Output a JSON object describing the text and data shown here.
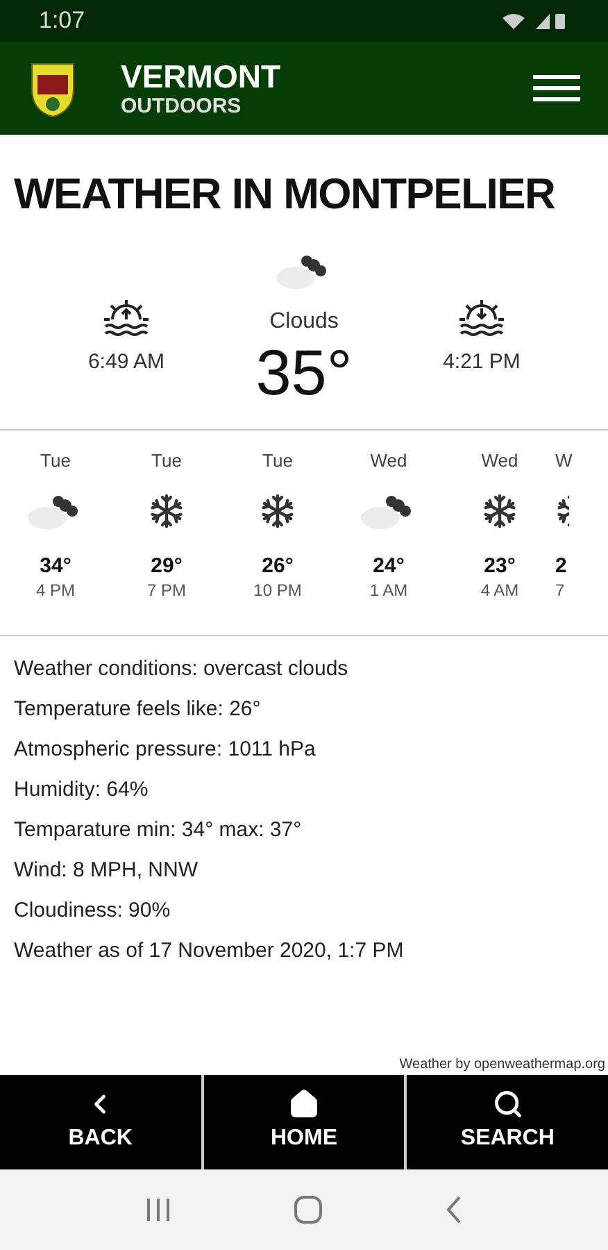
{
  "status_bar": {
    "time": "1:07"
  },
  "header": {
    "title": "VERMONT",
    "subtitle": "OUTDOORS"
  },
  "page_title": "WEATHER IN MONTPELIER",
  "current": {
    "sunrise": "6:49 AM",
    "condition": "Clouds",
    "kind": "clouds",
    "temperature": "35°",
    "sunset": "4:21 PM"
  },
  "forecast": [
    {
      "day": "Tue",
      "kind": "clouds",
      "temp": "34°",
      "time": "4 PM"
    },
    {
      "day": "Tue",
      "kind": "snow",
      "temp": "29°",
      "time": "7 PM"
    },
    {
      "day": "Tue",
      "kind": "snow",
      "temp": "26°",
      "time": "10 PM"
    },
    {
      "day": "Wed",
      "kind": "clouds",
      "temp": "24°",
      "time": "1 AM"
    },
    {
      "day": "Wed",
      "kind": "snow",
      "temp": "23°",
      "time": "4 AM"
    },
    {
      "day": "W",
      "kind": "snow",
      "temp": "2",
      "time": "7"
    }
  ],
  "details": [
    "Weather conditions: overcast clouds",
    "Temperature feels like: 26°",
    "Atmospheric pressure: 1011 hPa",
    "Humidity: 64%",
    "Temparature min: 34° max: 37°",
    "Wind: 8 MPH, NNW",
    "Cloudiness: 90%",
    "Weather as of 17 November 2020, 1:7 PM"
  ],
  "attribution": "Weather by openweathermap.org",
  "bottom_nav": [
    {
      "kind": "back",
      "label": "BACK"
    },
    {
      "kind": "home",
      "label": "HOME"
    },
    {
      "kind": "search",
      "label": "SEARCH"
    }
  ]
}
